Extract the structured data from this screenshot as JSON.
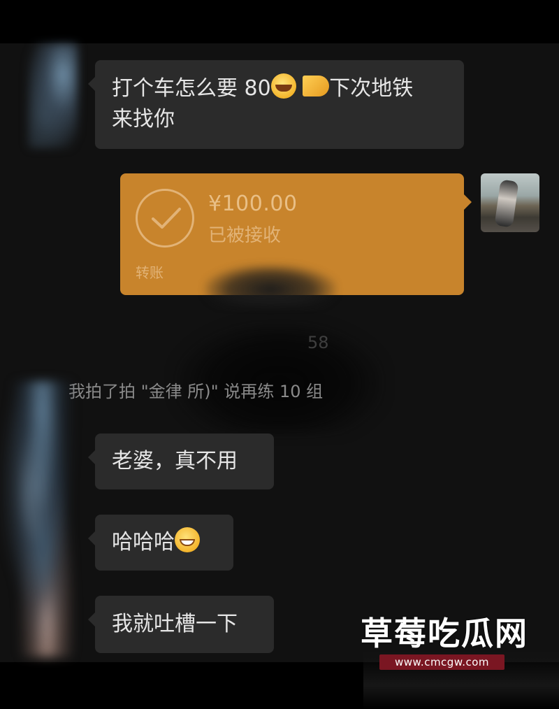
{
  "chat": {
    "messages": [
      {
        "side": "left",
        "text_before": "打个车怎么要 80",
        "emojis": [
          "crying-laughing-emoji",
          "ok-hand-emoji"
        ],
        "text_after": "下次地铁",
        "text_line2": "来找你"
      },
      {
        "side": "right",
        "type": "transfer",
        "amount": "¥100.00",
        "status": "已被接收",
        "label": "转账"
      },
      {
        "side": "left",
        "text": "老婆，真不用"
      },
      {
        "side": "left",
        "text": "哈哈哈",
        "emojis": [
          "grinning-emoji"
        ]
      },
      {
        "side": "left",
        "text": "我就吐槽一下"
      }
    ],
    "system": {
      "time_fragment": "58",
      "pat_text": "我拍了拍 \"金律                              所)\" 说再练 10 组"
    }
  },
  "watermark": {
    "title": "草莓吃瓜网",
    "url": "www.cmcgw.com"
  },
  "colors": {
    "background": "#111111",
    "bubble": "#2b2b2b",
    "transfer": "#c8842c",
    "watermark_band": "#7a1622"
  }
}
